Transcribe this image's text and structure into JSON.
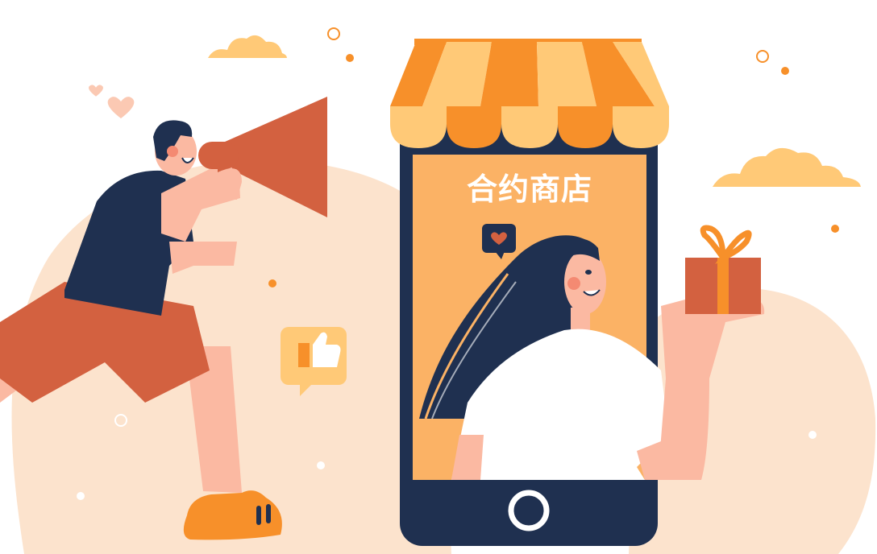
{
  "phone": {
    "screen_title": "合约商店"
  },
  "colors": {
    "accent_orange": "#F7902A",
    "light_orange": "#FFC977",
    "navy": "#1F3050",
    "rust": "#D36140",
    "skin": "#FBB9A2",
    "blob_peach": "#FCE3CD",
    "screen_bg": "#FBB265"
  },
  "icons": [
    "megaphone-icon",
    "gift-box-icon",
    "thumbs-up-icon",
    "heart-icon",
    "cloud-icon",
    "awning-icon",
    "home-button-icon"
  ]
}
